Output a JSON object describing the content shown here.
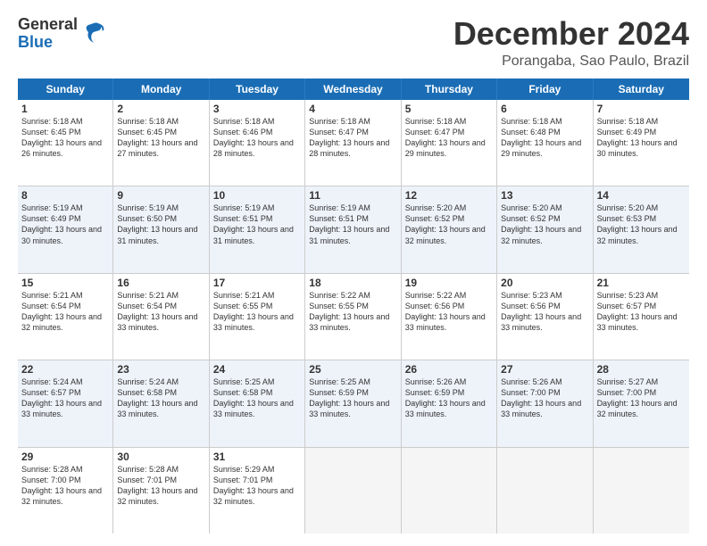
{
  "header": {
    "logo_line1": "General",
    "logo_line2": "Blue",
    "title": "December 2024",
    "subtitle": "Porangaba, Sao Paulo, Brazil"
  },
  "days": [
    "Sunday",
    "Monday",
    "Tuesday",
    "Wednesday",
    "Thursday",
    "Friday",
    "Saturday"
  ],
  "weeks": [
    [
      {
        "day": "1",
        "sunrise": "5:18 AM",
        "sunset": "6:45 PM",
        "daylight": "13 hours and 26 minutes."
      },
      {
        "day": "2",
        "sunrise": "5:18 AM",
        "sunset": "6:45 PM",
        "daylight": "13 hours and 27 minutes."
      },
      {
        "day": "3",
        "sunrise": "5:18 AM",
        "sunset": "6:46 PM",
        "daylight": "13 hours and 28 minutes."
      },
      {
        "day": "4",
        "sunrise": "5:18 AM",
        "sunset": "6:47 PM",
        "daylight": "13 hours and 28 minutes."
      },
      {
        "day": "5",
        "sunrise": "5:18 AM",
        "sunset": "6:47 PM",
        "daylight": "13 hours and 29 minutes."
      },
      {
        "day": "6",
        "sunrise": "5:18 AM",
        "sunset": "6:48 PM",
        "daylight": "13 hours and 29 minutes."
      },
      {
        "day": "7",
        "sunrise": "5:18 AM",
        "sunset": "6:49 PM",
        "daylight": "13 hours and 30 minutes."
      }
    ],
    [
      {
        "day": "8",
        "sunrise": "5:19 AM",
        "sunset": "6:49 PM",
        "daylight": "13 hours and 30 minutes."
      },
      {
        "day": "9",
        "sunrise": "5:19 AM",
        "sunset": "6:50 PM",
        "daylight": "13 hours and 31 minutes."
      },
      {
        "day": "10",
        "sunrise": "5:19 AM",
        "sunset": "6:51 PM",
        "daylight": "13 hours and 31 minutes."
      },
      {
        "day": "11",
        "sunrise": "5:19 AM",
        "sunset": "6:51 PM",
        "daylight": "13 hours and 31 minutes."
      },
      {
        "day": "12",
        "sunrise": "5:20 AM",
        "sunset": "6:52 PM",
        "daylight": "13 hours and 32 minutes."
      },
      {
        "day": "13",
        "sunrise": "5:20 AM",
        "sunset": "6:52 PM",
        "daylight": "13 hours and 32 minutes."
      },
      {
        "day": "14",
        "sunrise": "5:20 AM",
        "sunset": "6:53 PM",
        "daylight": "13 hours and 32 minutes."
      }
    ],
    [
      {
        "day": "15",
        "sunrise": "5:21 AM",
        "sunset": "6:54 PM",
        "daylight": "13 hours and 32 minutes."
      },
      {
        "day": "16",
        "sunrise": "5:21 AM",
        "sunset": "6:54 PM",
        "daylight": "13 hours and 33 minutes."
      },
      {
        "day": "17",
        "sunrise": "5:21 AM",
        "sunset": "6:55 PM",
        "daylight": "13 hours and 33 minutes."
      },
      {
        "day": "18",
        "sunrise": "5:22 AM",
        "sunset": "6:55 PM",
        "daylight": "13 hours and 33 minutes."
      },
      {
        "day": "19",
        "sunrise": "5:22 AM",
        "sunset": "6:56 PM",
        "daylight": "13 hours and 33 minutes."
      },
      {
        "day": "20",
        "sunrise": "5:23 AM",
        "sunset": "6:56 PM",
        "daylight": "13 hours and 33 minutes."
      },
      {
        "day": "21",
        "sunrise": "5:23 AM",
        "sunset": "6:57 PM",
        "daylight": "13 hours and 33 minutes."
      }
    ],
    [
      {
        "day": "22",
        "sunrise": "5:24 AM",
        "sunset": "6:57 PM",
        "daylight": "13 hours and 33 minutes."
      },
      {
        "day": "23",
        "sunrise": "5:24 AM",
        "sunset": "6:58 PM",
        "daylight": "13 hours and 33 minutes."
      },
      {
        "day": "24",
        "sunrise": "5:25 AM",
        "sunset": "6:58 PM",
        "daylight": "13 hours and 33 minutes."
      },
      {
        "day": "25",
        "sunrise": "5:25 AM",
        "sunset": "6:59 PM",
        "daylight": "13 hours and 33 minutes."
      },
      {
        "day": "26",
        "sunrise": "5:26 AM",
        "sunset": "6:59 PM",
        "daylight": "13 hours and 33 minutes."
      },
      {
        "day": "27",
        "sunrise": "5:26 AM",
        "sunset": "7:00 PM",
        "daylight": "13 hours and 33 minutes."
      },
      {
        "day": "28",
        "sunrise": "5:27 AM",
        "sunset": "7:00 PM",
        "daylight": "13 hours and 32 minutes."
      }
    ],
    [
      {
        "day": "29",
        "sunrise": "5:28 AM",
        "sunset": "7:00 PM",
        "daylight": "13 hours and 32 minutes."
      },
      {
        "day": "30",
        "sunrise": "5:28 AM",
        "sunset": "7:01 PM",
        "daylight": "13 hours and 32 minutes."
      },
      {
        "day": "31",
        "sunrise": "5:29 AM",
        "sunset": "7:01 PM",
        "daylight": "13 hours and 32 minutes."
      },
      null,
      null,
      null,
      null
    ]
  ]
}
